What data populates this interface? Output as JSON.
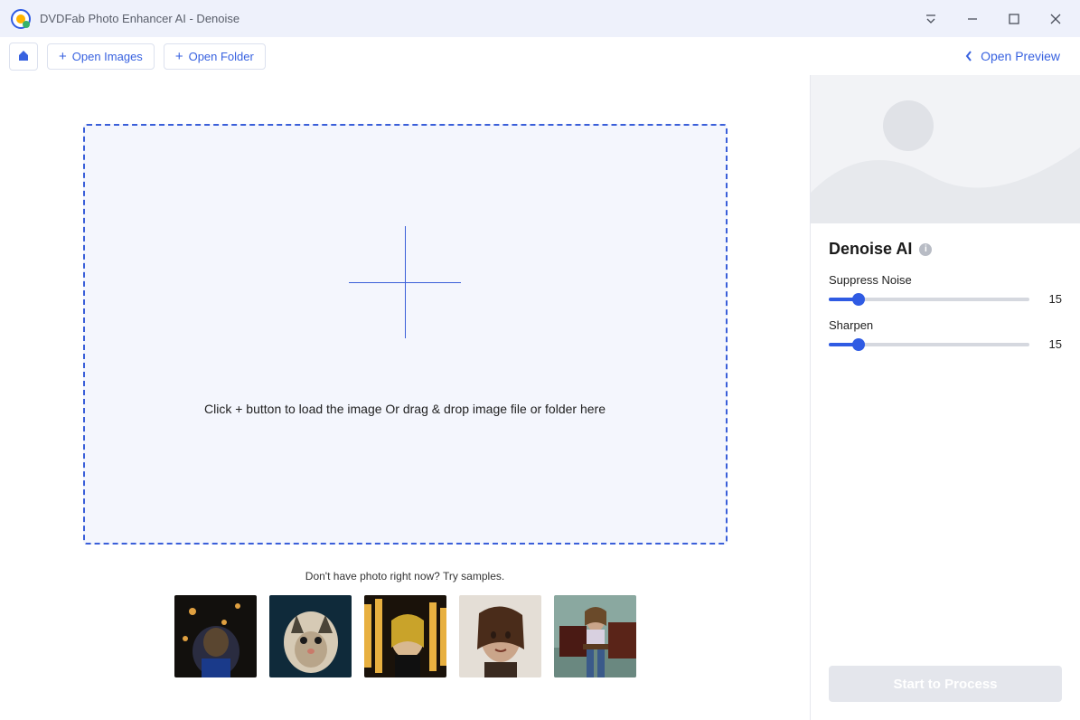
{
  "title": "DVDFab Photo Enhancer AI - Denoise",
  "toolbar": {
    "open_images": "Open Images",
    "open_folder": "Open Folder",
    "open_preview": "Open Preview"
  },
  "dropzone": {
    "text": "Click + button to load the image Or drag & drop image file or folder here"
  },
  "samples_caption": "Don't have photo right now? Try samples.",
  "side": {
    "title": "Denoise AI",
    "sliders": [
      {
        "label": "Suppress Noise",
        "value": 15,
        "max": 100
      },
      {
        "label": "Sharpen",
        "value": 15,
        "max": 100
      }
    ],
    "process_label": "Start to Process"
  }
}
